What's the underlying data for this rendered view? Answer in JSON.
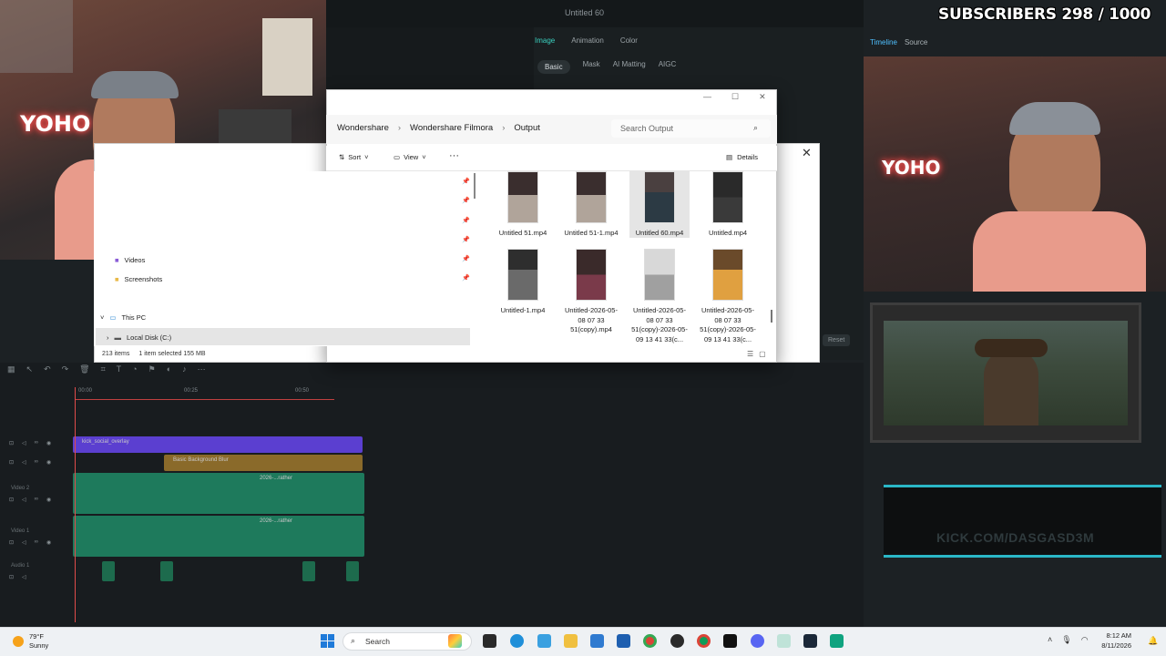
{
  "overlay": {
    "subscribers": "SUBSCRIBERS 298 / 1000",
    "neon_sign": "YOHO",
    "kick_url": "KICK.COM/DASGASD3M"
  },
  "filmora": {
    "project_title": "Untitled 60",
    "property_tabs": [
      "Image",
      "Animation",
      "Color"
    ],
    "sub_tabs": [
      "Basic",
      "Mask",
      "AI Matting",
      "AIGC"
    ],
    "right_header": [
      "Timeline",
      "Source"
    ],
    "reset_label": "Reset",
    "timeline_ticks": [
      "00:00",
      "00:25",
      "00:50"
    ],
    "tracks": {
      "overlay": "kick_social_overlay",
      "bg": "Basic Background Blur",
      "video2_clip": "2026-...rather",
      "video1_clip": "2026-...rather",
      "video2_label": "Video 2",
      "video1_label": "Video 1",
      "audio1_label": "Audio 1"
    }
  },
  "explorer": {
    "breadcrumbs": [
      "Wondershare",
      "Wondershare Filmora",
      "Output"
    ],
    "search_placeholder": "Search Output",
    "cmd": {
      "sort": "Sort",
      "view": "View",
      "more": "···",
      "details": "Details"
    },
    "nav": {
      "videos": "Videos",
      "screenshots": "Screenshots",
      "this_pc": "This PC",
      "local_disk": "Local Disk (C:)"
    },
    "files": [
      {
        "name": "Untitled 51.mp4"
      },
      {
        "name": "Untitled 51-1.mp4"
      },
      {
        "name": "Untitled 60.mp4"
      },
      {
        "name": "Untitled.mp4"
      },
      {
        "name": "Untitled-1.mp4"
      },
      {
        "name": "Untitled-2026-05-08 07 33 51(copy).mp4"
      },
      {
        "name": "Untitled-2026-05-08 07 33 51(copy)-2026-05-09 13 41 33(c..."
      },
      {
        "name": "Untitled-2026-05-08 07 33 51(copy)-2026-05-09 13 41 33(c..."
      }
    ],
    "status": {
      "count": "213 items",
      "selected": "1 item selected  155 MB"
    }
  },
  "taskbar": {
    "weather_temp": "79°F",
    "weather_desc": "Sunny",
    "search_label": "Search",
    "time": "8:12 AM",
    "date": "8/11/2026"
  },
  "colors": {
    "accent": "#3ad1c0",
    "kick_border": "#2ab7c7",
    "overlay_track": "#5b3fd0",
    "bg_track": "#b8862a",
    "video_track": "#1e7a5c",
    "audio_track": "#1d6b4d",
    "playhead": "#e14b4b"
  }
}
